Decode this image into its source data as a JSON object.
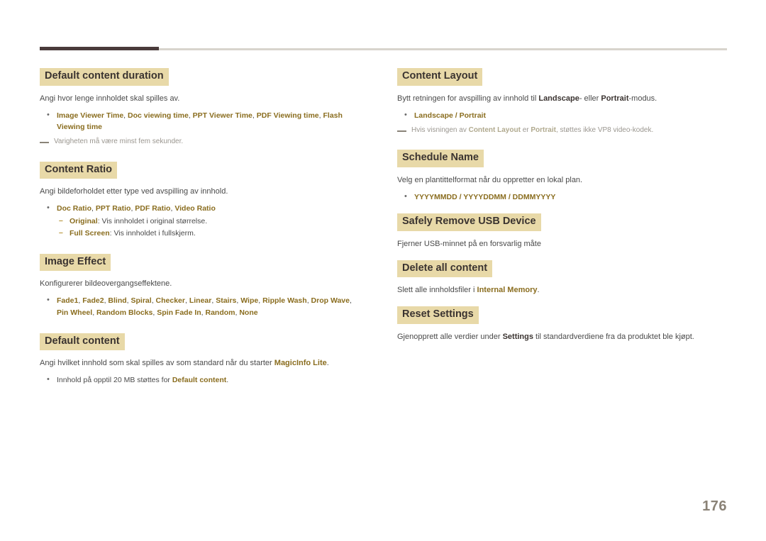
{
  "page": {
    "number": "176"
  },
  "left_column": {
    "sections": [
      {
        "title": "Default content duration",
        "desc": "Angi hvor lenge innholdet skal spilles av.",
        "bullet_html": "<b class=\"kw\">Image Viewer Time</b>, <b class=\"kw\">Doc viewing time</b>, <b class=\"kw\">PPT Viewer Time</b>, <b class=\"kw\">PDF Viewing time</b>, <b class=\"kw\">Flash Viewing time</b>",
        "note": "Varigheten må være minst fem sekunder."
      },
      {
        "title": "Content Ratio",
        "desc": "Angi bildeforholdet etter type ved avspilling av innhold.",
        "bullet_html": "<b class=\"kw\">Doc Ratio</b>, <b class=\"kw\">PPT Ratio</b>, <b class=\"kw\">PDF Ratio</b>, <b class=\"kw\">Video Ratio</b>",
        "subbullets_html": [
          "<b class=\"kw\">Original</b>: Vis innholdet i original størrelse.",
          "<b class=\"kw\">Full Screen</b>: Vis innholdet i fullskjerm."
        ]
      },
      {
        "title": "Image Effect",
        "desc": "Konfigurerer bildeovergangseffektene.",
        "bullet_html": "<b class=\"kw\">Fade1</b>, <b class=\"kw\">Fade2</b>, <b class=\"kw\">Blind</b>, <b class=\"kw\">Spiral</b>, <b class=\"kw\">Checker</b>, <b class=\"kw\">Linear</b>, <b class=\"kw\">Stairs</b>, <b class=\"kw\">Wipe</b>, <b class=\"kw\">Ripple Wash</b>, <b class=\"kw\">Drop Wave</b>, <b class=\"kw\">Pin Wheel</b>, <b class=\"kw\">Random Blocks</b>, <b class=\"kw\">Spin Fade In</b>, <b class=\"kw\">Random</b>, <b class=\"kw\">None</b>"
      },
      {
        "title": "Default content",
        "desc_html": "Angi hvilket innhold som skal spilles av som standard når du starter <b class=\"kw\">MagicInfo Lite</b>.",
        "bullet_html": "Innhold på opptil 20 MB støttes for <b class=\"kw\">Default content</b>."
      }
    ]
  },
  "right_column": {
    "sections": [
      {
        "title": "Content Layout",
        "desc_html": "Bytt retningen for avspilling av innhold til <b class=\"kw-dark\">Landscape</b>- eller <b class=\"kw-dark\">Portrait</b>-modus.",
        "bullet_html": "<b class=\"kw\">Landscape / Portrait</b>",
        "note_html": "Hvis visningen av <b class=\"kw\">Content Layout</b> er <b class=\"kw\">Portrait</b>, støttes ikke VP8 video-kodek."
      },
      {
        "title": "Schedule Name",
        "desc": "Velg en plantittelformat når du oppretter en lokal plan.",
        "bullet_html": "<b class=\"kw\">YYYYMMDD / YYYYDDMM / DDMMYYYY</b>"
      },
      {
        "title": "Safely Remove USB Device",
        "desc": "Fjerner USB-minnet på en forsvarlig måte"
      },
      {
        "title": "Delete all content",
        "desc_html": "Slett alle innholdsfiler i <b class=\"kw\">Internal Memory</b>."
      },
      {
        "title": "Reset Settings",
        "desc_html": "Gjenopprett alle verdier under <b class=\"kw-dark\">Settings</b> til standardverdiene fra da produktet ble kjøpt."
      }
    ]
  }
}
